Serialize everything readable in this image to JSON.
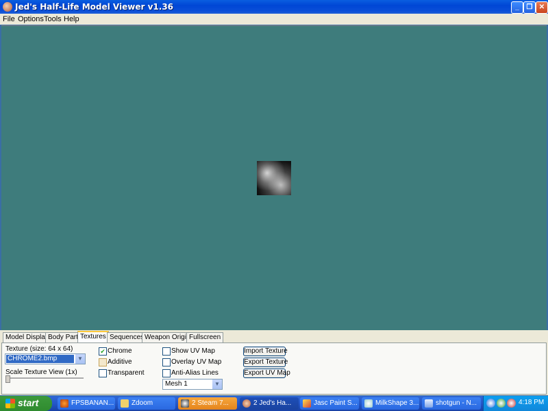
{
  "window": {
    "title": "Jed's Half-Life Model Viewer v1.36",
    "controls": {
      "minimize": "_",
      "maximize": "❐",
      "close": "✕"
    }
  },
  "menu": {
    "items": [
      "File",
      "Options",
      "Tools",
      "Help"
    ]
  },
  "tabs": [
    {
      "label": "Model Display",
      "active": false
    },
    {
      "label": "Body Parts",
      "active": false
    },
    {
      "label": "Textures",
      "active": true
    },
    {
      "label": "Sequences",
      "active": false
    },
    {
      "label": "Weapon Origin",
      "active": false
    },
    {
      "label": "Fullscreen",
      "active": false
    }
  ],
  "textures_panel": {
    "texture_label": "Texture (size: 64 x 64)",
    "texture_value": "CHROME2.bmp",
    "scale_label": "Scale Texture View (1x)",
    "checkboxes": {
      "chrome": {
        "label": "Chrome",
        "checked": true
      },
      "additive": {
        "label": "Additive",
        "checked": false
      },
      "transparent": {
        "label": "Transparent",
        "checked": false
      },
      "show_uv": {
        "label": "Show UV Map",
        "checked": false
      },
      "overlay_uv": {
        "label": "Overlay UV Map",
        "checked": false
      },
      "anti_alias": {
        "label": "Anti-Alias Lines",
        "checked": false
      }
    },
    "mesh_value": "Mesh 1",
    "buttons": {
      "import": "Import Texture",
      "export": "Export Texture",
      "export_uv": "Export UV Map"
    }
  },
  "colors": {
    "viewport": "#3e7c7c",
    "titlebar": "#0a5ee0",
    "taskbar": "#2457c9"
  },
  "taskbar": {
    "start_label": "start",
    "tasks": [
      {
        "label": "FPSBANAN...",
        "icon": "firefox-icon"
      },
      {
        "label": "Zdoom",
        "icon": "folder-icon"
      },
      {
        "label": "2 Steam 7...",
        "icon": "steam-icon"
      },
      {
        "label": "2 Jed's Ha...",
        "icon": "jed-icon"
      },
      {
        "label": "Jasc Paint S...",
        "icon": "paint-icon"
      },
      {
        "label": "MilkShape 3...",
        "icon": "milkshape-icon"
      },
      {
        "label": "shotgun - N...",
        "icon": "notepad-icon"
      }
    ],
    "clock": "4:18 PM"
  }
}
